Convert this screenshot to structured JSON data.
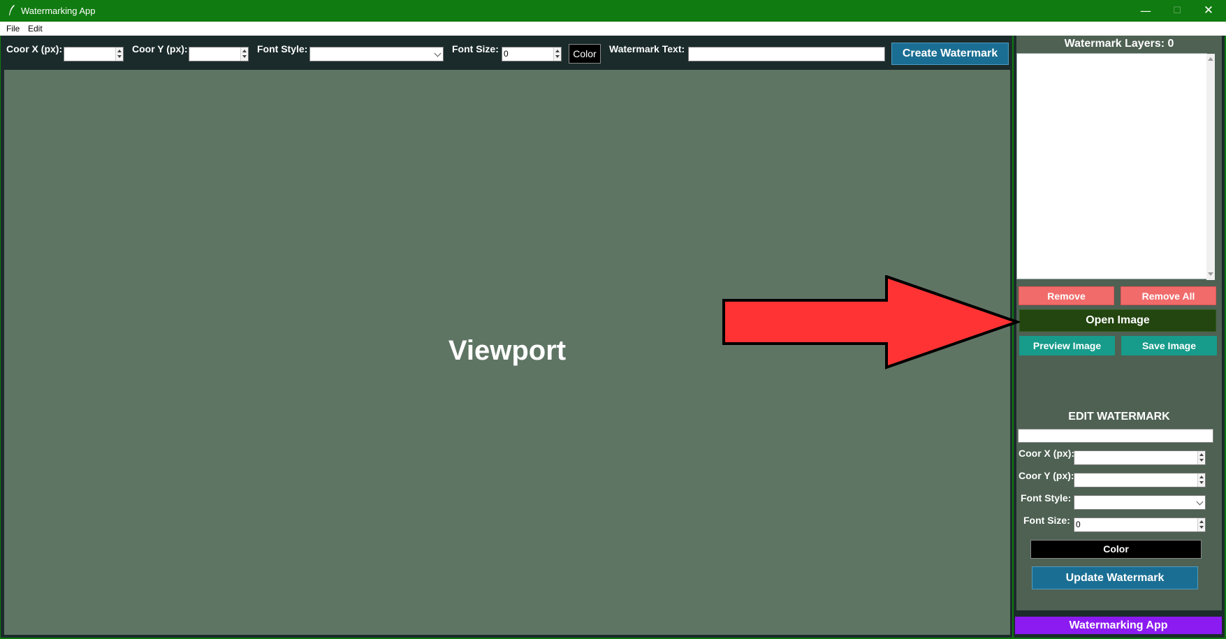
{
  "window": {
    "title": "Watermarking App"
  },
  "menu": {
    "items": [
      "File",
      "Edit"
    ]
  },
  "toolbar": {
    "coor_x_label": "Coor X (px):",
    "coor_x_value": "",
    "coor_y_label": "Coor Y (px):",
    "coor_y_value": "",
    "font_style_label": "Font Style:",
    "font_style_value": "",
    "font_size_label": "Font Size:",
    "font_size_value": "0",
    "color_label": "Color",
    "watermark_text_label": "Watermark Text:",
    "watermark_text_value": "",
    "create_label": "Create Watermark"
  },
  "viewport": {
    "label": "Viewport"
  },
  "layers": {
    "title": "Watermark Layers: 0",
    "items": []
  },
  "actions": {
    "remove": "Remove",
    "remove_all": "Remove All",
    "open": "Open Image",
    "preview": "Preview Image",
    "save": "Save Image"
  },
  "edit": {
    "title": "EDIT WATERMARK",
    "name_value": "",
    "coor_x_label": "Coor X (px):",
    "coor_x_value": "",
    "coor_y_label": "Coor Y (px):",
    "coor_y_value": "",
    "font_style_label": "Font Style:",
    "font_style_value": "",
    "font_size_label": "Font Size:",
    "font_size_value": "0",
    "color_label": "Color",
    "update_label": "Update Watermark"
  },
  "footer": {
    "label": "Watermarking App"
  },
  "colors": {
    "titlebar": "#107b10",
    "panel_bg": "#1b2b2b",
    "viewport_bg": "#5f7564",
    "side_bg": "#4e6153",
    "primary_button": "#1a6e93",
    "danger_button": "#f16b6b",
    "open_button": "#234510",
    "teal_button": "#179b8a",
    "footer": "#8b1bf0",
    "annotation_arrow": "#ff3333"
  }
}
